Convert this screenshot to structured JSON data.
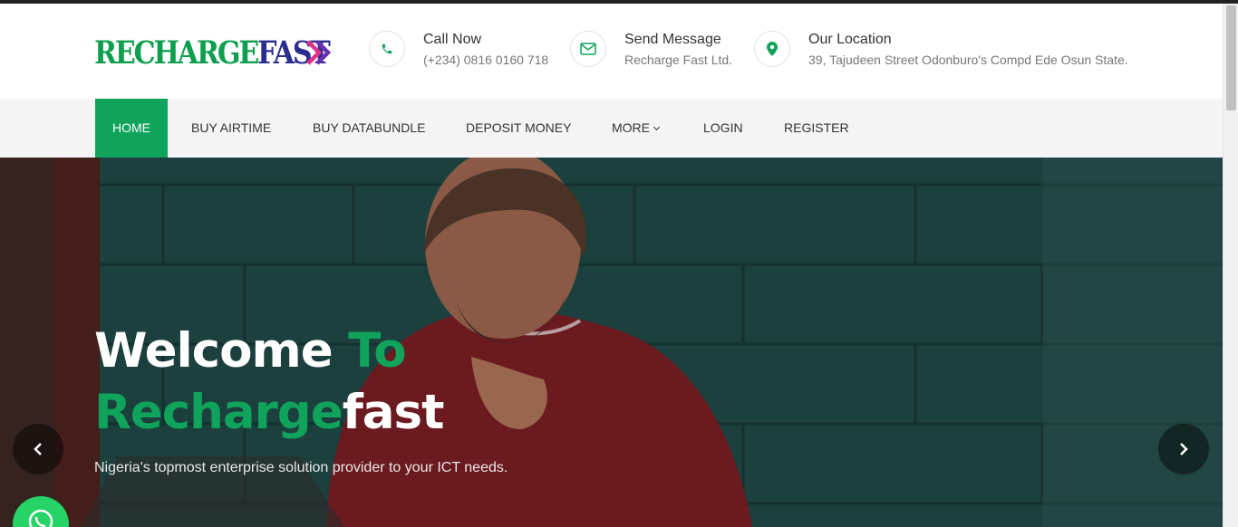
{
  "brand": {
    "logo_part1": "RECHARGE",
    "logo_part2": "FAST",
    "logo_colors": {
      "part1": "#0e9f4e",
      "part2": "#2b2e8f",
      "arrow_pink": "#e0308a",
      "arrow_purple": "#6a2fb0"
    }
  },
  "contacts": [
    {
      "icon": "phone-icon",
      "title": "Call Now",
      "detail": "(+234) 0816 0160 718"
    },
    {
      "icon": "envelope-icon",
      "title": "Send Message",
      "detail": "Recharge Fast Ltd."
    },
    {
      "icon": "map-pin-icon",
      "title": "Our Location",
      "detail": "39, Tajudeen Street Odonburo's Compd Ede Osun State."
    }
  ],
  "nav": {
    "items": [
      {
        "label": "HOME",
        "active": true
      },
      {
        "label": "BUY AIRTIME"
      },
      {
        "label": "BUY DATABUNDLE"
      },
      {
        "label": "DEPOSIT MONEY"
      },
      {
        "label": "MORE",
        "dropdown": true
      },
      {
        "label": "LOGIN"
      },
      {
        "label": "REGISTER"
      }
    ]
  },
  "hero": {
    "title_welcome": "Welcome ",
    "title_to": "To",
    "title_recharge": "Recharge",
    "title_fast": "fast",
    "subtitle": "Nigeria's topmost enterprise solution provider to your ICT needs."
  },
  "slider": {
    "prev_icon": "chevron-left-icon",
    "next_icon": "chevron-right-icon"
  },
  "whatsapp": {
    "icon": "whatsapp-icon"
  },
  "colors": {
    "accent": "#0fa35b",
    "hero_overlay": "#183a38",
    "nav_bg": "#f4f4f4"
  }
}
